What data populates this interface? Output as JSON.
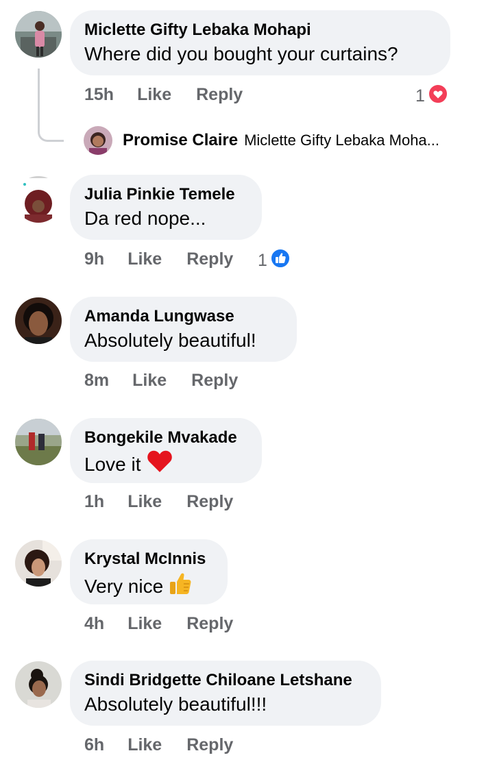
{
  "comments": [
    {
      "author": "Miclette Gifty Lebaka Mohapi",
      "text": "Where did you bought your curtains?",
      "time": "15h",
      "like": "Like",
      "reply": "Reply",
      "reaction_count": "1",
      "reaction": "love-icon"
    },
    {
      "author": "Julia Pinkie Temele",
      "text": "Da red nope...",
      "time": "9h",
      "like": "Like",
      "reply": "Reply",
      "reaction_count": "1",
      "reaction": "like-icon"
    },
    {
      "author": "Amanda Lungwase",
      "text": "Absolutely beautiful!",
      "time": "8m",
      "like": "Like",
      "reply": "Reply"
    },
    {
      "author": "Bongekile Mvakade",
      "text": "Love it",
      "emoji": "red-heart-emoji",
      "time": "1h",
      "like": "Like",
      "reply": "Reply"
    },
    {
      "author": "Krystal McInnis",
      "text": "Very nice",
      "emoji": "thumbs-up-emoji",
      "time": "4h",
      "like": "Like",
      "reply": "Reply"
    },
    {
      "author": "Sindi Bridgette Chiloane Letshane",
      "text": "Absolutely beautiful!!!",
      "time": "6h",
      "like": "Like",
      "reply": "Reply"
    }
  ],
  "reply_preview": {
    "author": "Promise Claire",
    "text": "Miclette Gifty Lebaka Moha..."
  },
  "colors": {
    "bubble": "#f0f2f5",
    "meta_text": "#65676b",
    "love": "#f33e58",
    "like": "#1877f2"
  }
}
